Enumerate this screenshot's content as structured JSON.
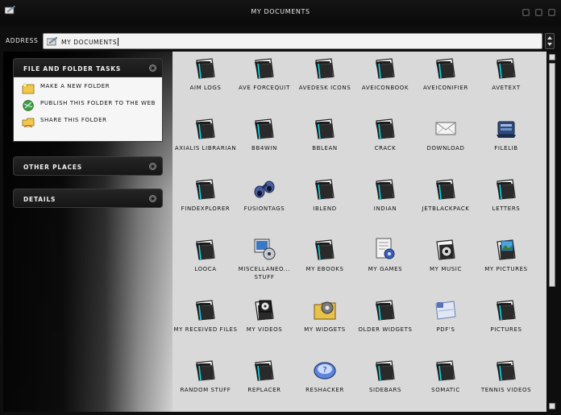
{
  "window": {
    "title": "My Documents"
  },
  "address": {
    "label": "Address",
    "value": "My Documents"
  },
  "tasks": {
    "file_folder": {
      "title": "File and Folder Tasks",
      "items": [
        {
          "label": "Make a new folder",
          "icon": "new-folder-icon"
        },
        {
          "label": "Publish this folder to the Web",
          "icon": "publish-web-icon"
        },
        {
          "label": "Share this folder",
          "icon": "share-folder-icon"
        }
      ]
    },
    "other_places": {
      "title": "Other Places"
    },
    "details": {
      "title": "Details"
    }
  },
  "items": [
    {
      "label": "AIM Logs",
      "icon": "folder"
    },
    {
      "label": "Ave ForceQuit",
      "icon": "folder"
    },
    {
      "label": "AveDesk Icons",
      "icon": "folder"
    },
    {
      "label": "AveIconBook",
      "icon": "folder"
    },
    {
      "label": "AveIconifier",
      "icon": "folder"
    },
    {
      "label": "AveText",
      "icon": "folder"
    },
    {
      "label": "Axialis Librarian",
      "icon": "folder"
    },
    {
      "label": "BB4Win",
      "icon": "folder"
    },
    {
      "label": "BBLean",
      "icon": "folder"
    },
    {
      "label": "crack",
      "icon": "folder"
    },
    {
      "label": "Download",
      "icon": "envelope"
    },
    {
      "label": "FileLib",
      "icon": "filelib"
    },
    {
      "label": "FindExplorer",
      "icon": "folder"
    },
    {
      "label": "FusionTags",
      "icon": "binoculars"
    },
    {
      "label": "iBlend",
      "icon": "folder"
    },
    {
      "label": "Indian",
      "icon": "folder"
    },
    {
      "label": "JetBlackPack",
      "icon": "folder"
    },
    {
      "label": "Letters",
      "icon": "folder"
    },
    {
      "label": "Looca",
      "icon": "folder"
    },
    {
      "label": "Miscellaneo... Stuff",
      "icon": "monitor"
    },
    {
      "label": "My eBooks",
      "icon": "folder"
    },
    {
      "label": "My Games",
      "icon": "games"
    },
    {
      "label": "My Music",
      "icon": "music"
    },
    {
      "label": "My Pictures",
      "icon": "pictures"
    },
    {
      "label": "My Received Files",
      "icon": "folder"
    },
    {
      "label": "My Videos",
      "icon": "videos"
    },
    {
      "label": "My Widgets",
      "icon": "widgets"
    },
    {
      "label": "Older Widgets",
      "icon": "folder"
    },
    {
      "label": "PDF's",
      "icon": "pdf"
    },
    {
      "label": "Pictures",
      "icon": "folder"
    },
    {
      "label": "Random Stuff",
      "icon": "folder"
    },
    {
      "label": "Replacer",
      "icon": "folder"
    },
    {
      "label": "ResHacker",
      "icon": "reshacker"
    },
    {
      "label": "Sidebars",
      "icon": "folder"
    },
    {
      "label": "Somatic",
      "icon": "folder"
    },
    {
      "label": "Tennis Videos",
      "icon": "folder"
    }
  ],
  "colors": {
    "content_bg": "#d9d9d9",
    "chrome_bg": "#0e0e0e",
    "folder_accent": "#14d8e6"
  }
}
